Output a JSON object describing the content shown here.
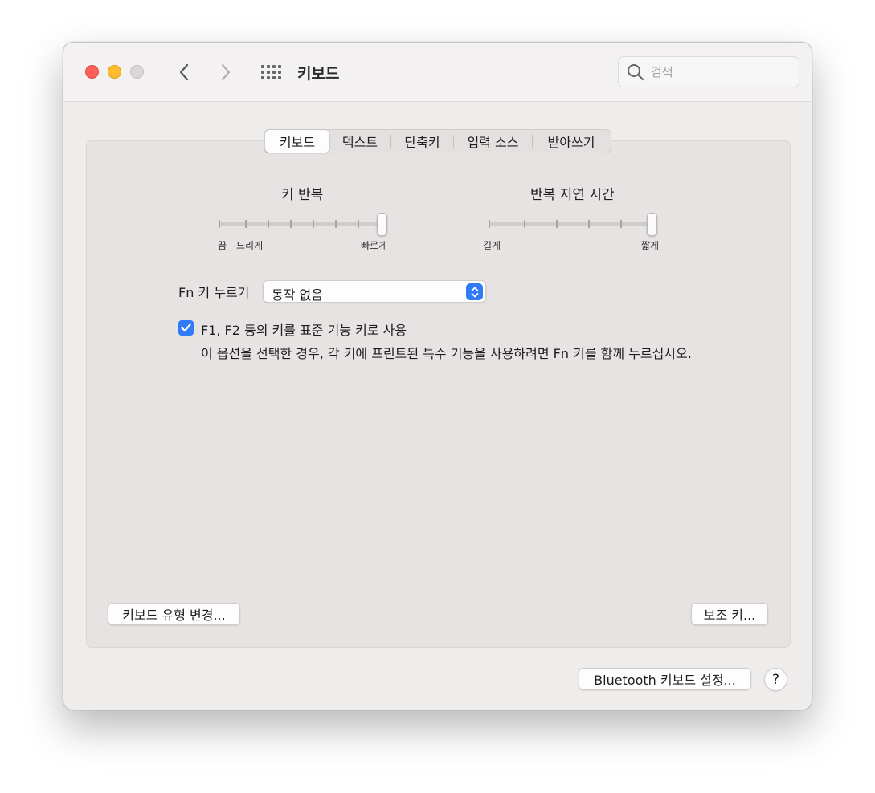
{
  "window": {
    "title": "키보드",
    "search_placeholder": "검색"
  },
  "tabs": [
    {
      "label": "키보드",
      "active": true
    },
    {
      "label": "텍스트",
      "active": false
    },
    {
      "label": "단축키",
      "active": false
    },
    {
      "label": "입력 소스",
      "active": false
    },
    {
      "label": "받아쓰기",
      "active": false
    }
  ],
  "key_repeat": {
    "title": "키 반복",
    "label_off": "끔",
    "label_slow": "느리게",
    "label_fast": "빠르게",
    "tick_count": 8,
    "value": 1.0
  },
  "repeat_delay": {
    "title": "반복 지연 시간",
    "label_long": "길게",
    "label_short": "짧게",
    "tick_count": 6,
    "value": 1.0
  },
  "fn_key": {
    "label": "Fn 키 누르기",
    "selected": "동작 없음"
  },
  "function_keys": {
    "checked": true,
    "label": "F1, F2 등의 키를 표준 기능 키로 사용",
    "description": "이 옵션을 선택한 경우, 각 키에 프린트된 특수 기능을 사용하려면 Fn 키를 함께 누르십시오."
  },
  "buttons": {
    "change_keyboard_type": "키보드 유형 변경...",
    "modifier_keys": "보조 키...",
    "bluetooth_setup": "Bluetooth 키보드 설정...",
    "help": "?"
  },
  "colors": {
    "accent": "#2f7cf6",
    "close": "#fe5f57",
    "minimize": "#febc2e",
    "zoom_disabled": "#d9d7d6"
  },
  "icons": [
    "back-chevron-icon",
    "forward-chevron-icon",
    "show-all-grid-icon",
    "search-icon",
    "checkmark-icon",
    "popup-chevrons-icon"
  ]
}
